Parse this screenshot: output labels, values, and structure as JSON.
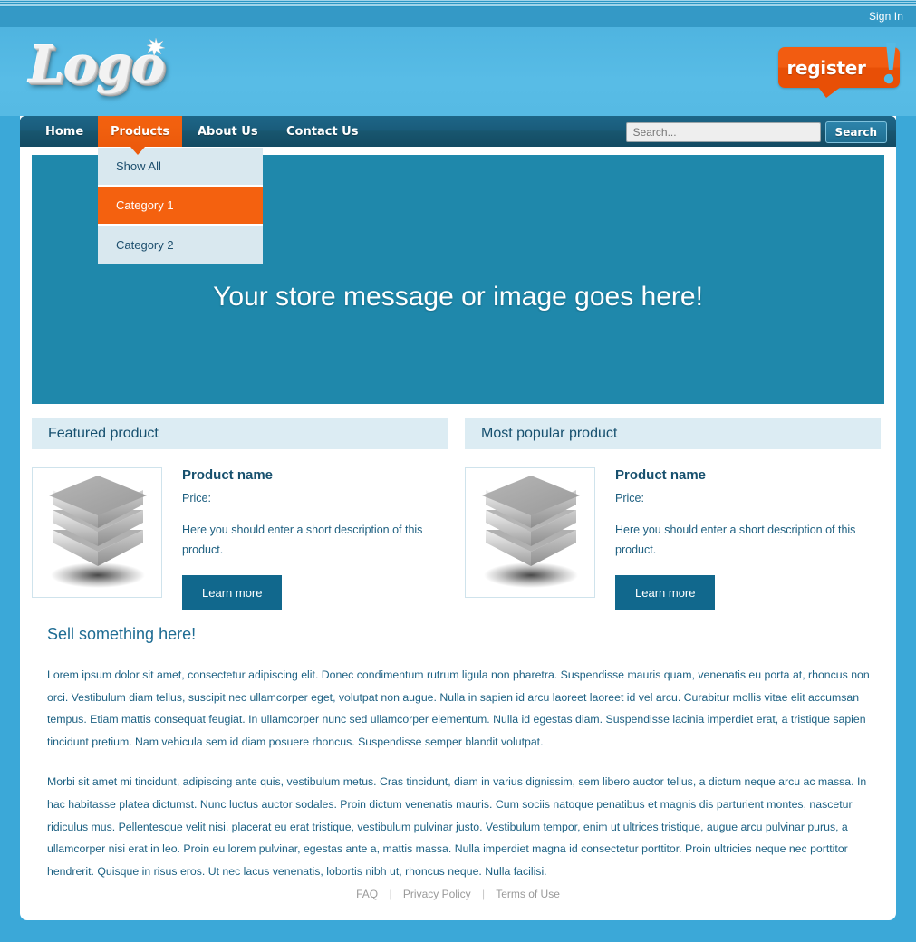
{
  "topbar": {
    "signin_label": "Sign In"
  },
  "header": {
    "logo_text": "Logo",
    "register_label": "register",
    "register_bang": "!"
  },
  "nav": {
    "items": [
      {
        "label": "Home",
        "active": false
      },
      {
        "label": "Products",
        "active": true
      },
      {
        "label": "About Us",
        "active": false
      },
      {
        "label": "Contact Us",
        "active": false
      }
    ],
    "search": {
      "placeholder": "Search...",
      "value": "",
      "button_label": "Search"
    }
  },
  "dropdown": {
    "items": [
      {
        "label": "Show All",
        "selected": false
      },
      {
        "label": "Category 1",
        "selected": true
      },
      {
        "label": "Category 2",
        "selected": false
      }
    ]
  },
  "hero": {
    "message": "Your store message or image goes here!"
  },
  "products": [
    {
      "panel_title": "Featured product",
      "name": "Product name",
      "price": "Price:",
      "description": "Here you should enter a short description of this product.",
      "button_label": "Learn more",
      "image": "stacked-layers-icon"
    },
    {
      "panel_title": "Most popular product",
      "name": "Product name",
      "price": "Price:",
      "description": "Here you should enter a short description of this product.",
      "button_label": "Learn more",
      "image": "stacked-layers-icon"
    }
  ],
  "sell": {
    "title": "Sell something here!",
    "paragraph_1": "Lorem ipsum dolor sit amet, consectetur adipiscing elit. Donec condimentum rutrum ligula non pharetra. Suspendisse mauris quam, venenatis eu porta at, rhoncus non orci. Vestibulum diam tellus, suscipit nec ullamcorper eget, volutpat non augue. Nulla in sapien id arcu laoreet laoreet id vel arcu. Curabitur mollis vitae elit accumsan tempus. Etiam mattis consequat feugiat. In ullamcorper nunc sed ullamcorper elementum. Nulla id egestas diam. Suspendisse lacinia imperdiet erat, a tristique sapien tincidunt pretium. Nam vehicula sem id diam posuere rhoncus. Suspendisse semper blandit volutpat.",
    "paragraph_2": "Morbi sit amet mi tincidunt, adipiscing ante quis, vestibulum metus. Cras tincidunt, diam in varius dignissim, sem libero auctor tellus, a dictum neque arcu ac massa. In hac habitasse platea dictumst. Nunc luctus auctor sodales. Proin dictum venenatis mauris. Cum sociis natoque penatibus et magnis dis parturient montes, nascetur ridiculus mus. Pellentesque velit nisi, placerat eu erat tristique, vestibulum pulvinar justo. Vestibulum tempor, enim ut ultrices tristique, augue arcu pulvinar purus, a ullamcorper nisi erat in leo. Proin eu lorem pulvinar, egestas ante a, mattis massa. Nulla imperdiet magna id consectetur porttitor. Proin ultricies neque nec porttitor hendrerit. Quisque in risus eros. Ut nec lacus venenatis, lobortis nibh ut, rhoncus neque. Nulla facilisi."
  },
  "footer": {
    "links": [
      {
        "label": "FAQ"
      },
      {
        "label": "Privacy Policy"
      },
      {
        "label": "Terms of Use"
      }
    ],
    "separator": "|"
  },
  "colors": {
    "page_bg": "#3ba8d8",
    "header_blue": "#56bae4",
    "nav_dark": "#1a5c7b",
    "accent_orange": "#f4610f",
    "hero_teal": "#1f88ab",
    "panel_head": "#dcecf3",
    "button_blue": "#11688d",
    "text_blue": "#1d6183"
  }
}
